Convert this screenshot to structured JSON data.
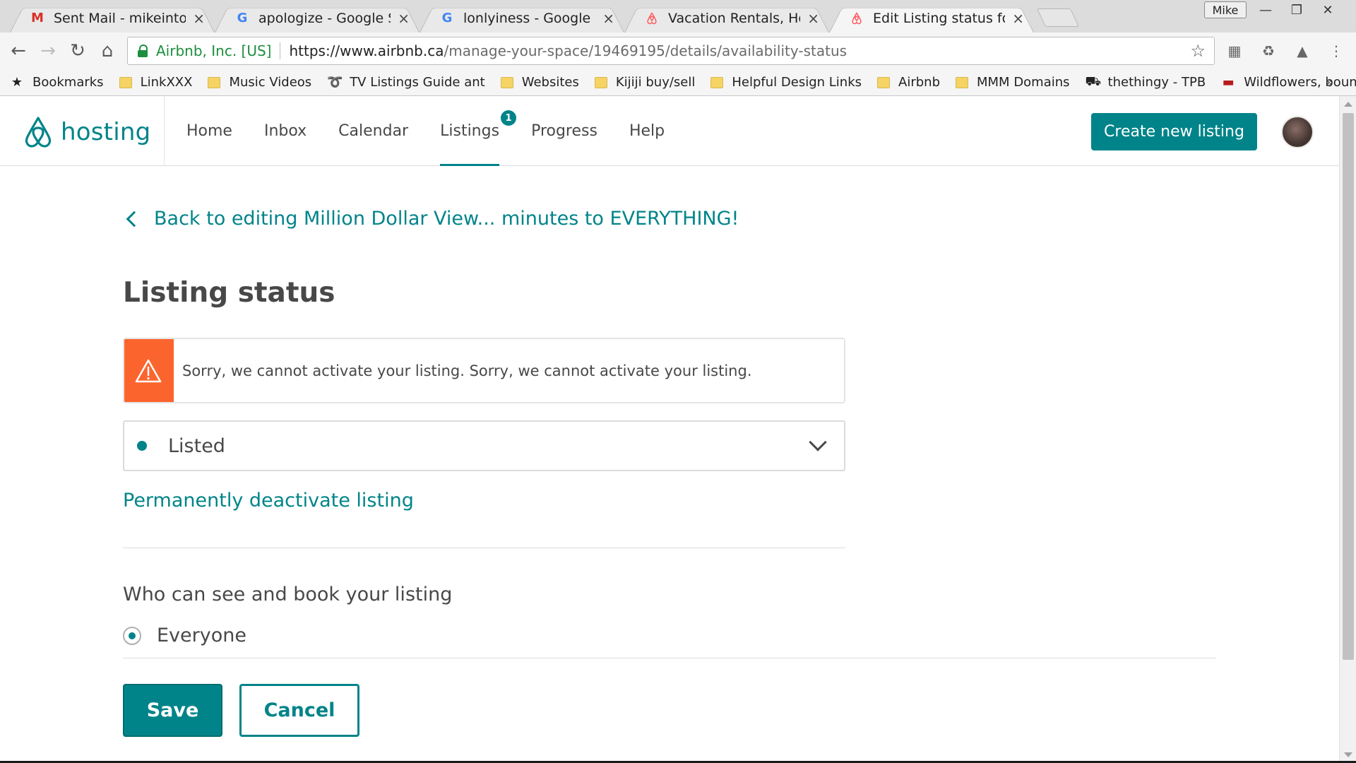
{
  "browser": {
    "tabs": [
      {
        "title": "Sent Mail - mikeinto@gn",
        "icon": "gmail-icon"
      },
      {
        "title": "apologize - Google Searc",
        "icon": "google-icon"
      },
      {
        "title": "lonlyiness - Google Searc",
        "icon": "google-icon"
      },
      {
        "title": "Vacation Rentals, Homes",
        "icon": "airbnb-icon"
      },
      {
        "title": "Edit Listing status for 'Mi",
        "icon": "airbnb-icon"
      }
    ],
    "profile_name": "Mike",
    "site_identity": "Airbnb, Inc. [US]",
    "url_host": "https://www.airbnb.ca",
    "url_path": "/manage-your-space/19469195/details/availability-status",
    "bookmarks": [
      {
        "label": "Bookmarks",
        "type": "star"
      },
      {
        "label": "LinkXXX",
        "type": "folder"
      },
      {
        "label": "Music Videos",
        "type": "folder"
      },
      {
        "label": "TV Listings Guide ant",
        "type": "site"
      },
      {
        "label": "Websites",
        "type": "folder"
      },
      {
        "label": "Kijiji buy/sell",
        "type": "folder"
      },
      {
        "label": "Helpful Design Links",
        "type": "folder"
      },
      {
        "label": "Airbnb",
        "type": "folder"
      },
      {
        "label": "MMM Domains",
        "type": "folder"
      },
      {
        "label": "thethingy - TPB",
        "type": "site"
      },
      {
        "label": "Wildflowers, boundle",
        "type": "site"
      }
    ],
    "bookmarks_overflow": "»"
  },
  "header": {
    "brand": "hosting",
    "nav": [
      {
        "label": "Home"
      },
      {
        "label": "Inbox"
      },
      {
        "label": "Calendar"
      },
      {
        "label": "Listings",
        "badge": "1",
        "active": true
      },
      {
        "label": "Progress"
      },
      {
        "label": "Help"
      }
    ],
    "create_button": "Create new listing"
  },
  "main": {
    "back_link": "Back to editing Million Dollar View... minutes to EVERYTHING!",
    "title": "Listing status",
    "alert_message": "Sorry, we cannot activate your listing. Sorry, we cannot activate your listing.",
    "status_value": "Listed",
    "deactivate_link": "Permanently deactivate listing",
    "visibility_title": "Who can see and book your listing",
    "visibility_option": "Everyone"
  },
  "footer": {
    "save": "Save",
    "cancel": "Cancel"
  },
  "colors": {
    "accent": "#008489",
    "alert": "#FC642D",
    "text": "#484848"
  }
}
